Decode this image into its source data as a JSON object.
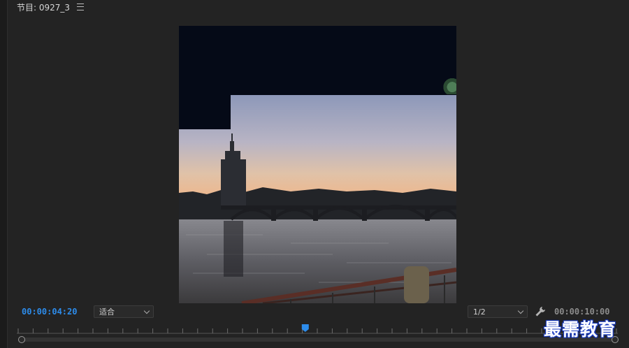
{
  "panel": {
    "title": "节目: 0927_3"
  },
  "controls": {
    "current_time": "00:00:04:20",
    "fit_label": "适合",
    "resolution_label": "1/2",
    "duration_time": "00:00:10:00"
  },
  "playhead": {
    "position_fraction": 0.48
  },
  "watermark": {
    "text": "最需教育"
  },
  "colors": {
    "accent": "#2d8ceb",
    "background": "#232323"
  }
}
